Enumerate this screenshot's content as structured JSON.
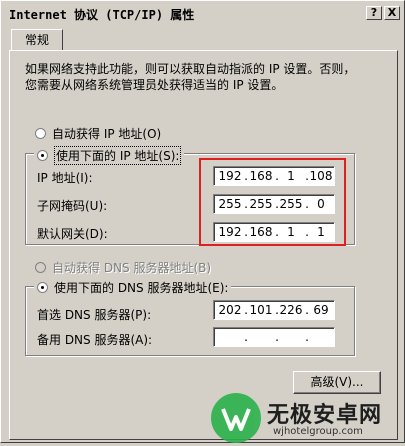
{
  "window": {
    "title": "Internet 协议 (TCP/IP) 属性",
    "help_btn": "?",
    "close_btn": "X"
  },
  "tabs": [
    {
      "label": "常规"
    }
  ],
  "intro": {
    "line1": "如果网络支持此功能，则可以获取自动指派的 IP 设置。否则，",
    "line2": "您需要从网络系统管理员处获得适当的 IP 设置。"
  },
  "ip_mode": {
    "auto_label": "自动获得 IP 地址(O)",
    "manual_label": "使用下面的 IP 地址(S):",
    "selected": "manual"
  },
  "ip_fields": [
    {
      "label": "IP 地址(I):",
      "octets": [
        "192",
        "168",
        "1",
        "108"
      ]
    },
    {
      "label": "子网掩码(U):",
      "octets": [
        "255",
        "255",
        "255",
        "0"
      ]
    },
    {
      "label": "默认网关(D):",
      "octets": [
        "192",
        "168",
        "1",
        "1"
      ]
    }
  ],
  "dns_mode": {
    "auto_label": "自动获得 DNS 服务器地址(B)",
    "manual_label": "使用下面的 DNS 服务器地址(E):",
    "selected": "manual"
  },
  "dns_fields": [
    {
      "label": "首选 DNS 服务器(P):",
      "octets": [
        "202",
        "101",
        "226",
        "69"
      ]
    },
    {
      "label": "备用 DNS 服务器(A):",
      "octets": [
        "",
        "",
        "",
        ""
      ]
    }
  ],
  "advanced_button": "高级(V)...",
  "watermark": {
    "name": "无极安卓网",
    "url": "wjhotelgroup.com"
  },
  "colors": {
    "highlight": "#e02020",
    "dialog_bg": "#d4d0c8"
  }
}
